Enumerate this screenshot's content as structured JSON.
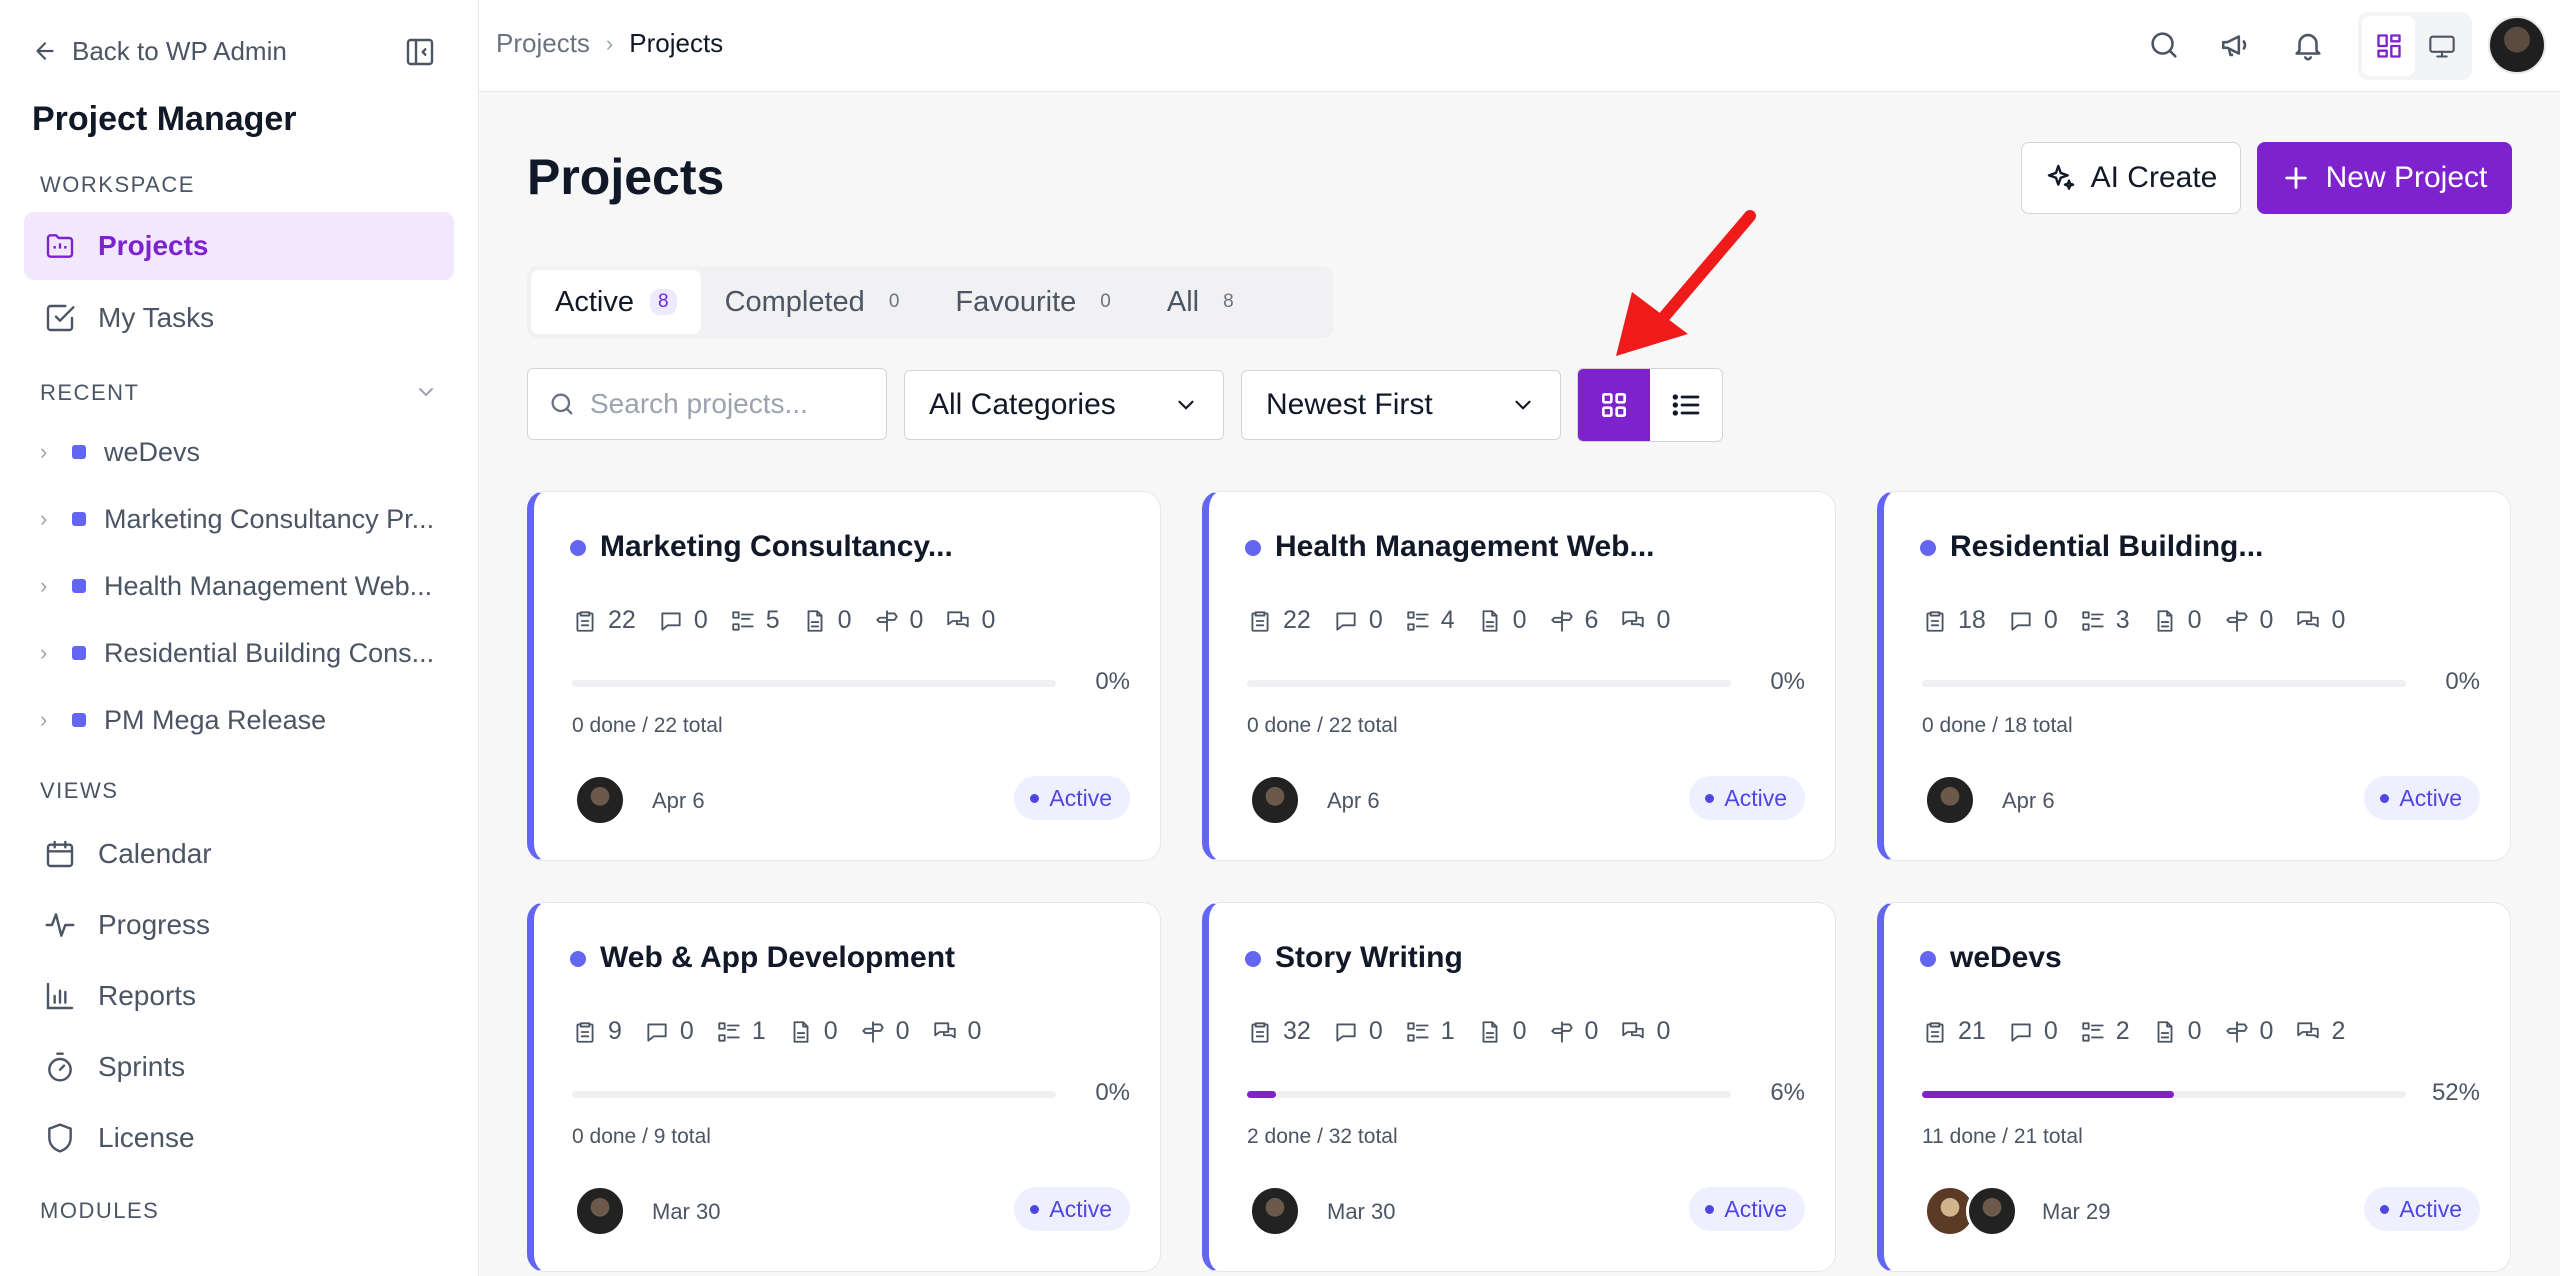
{
  "sidebar": {
    "back_label": "Back to WP Admin",
    "app_title": "Project Manager",
    "workspace_label": "WORKSPACE",
    "workspace_items": [
      {
        "label": "Projects",
        "icon": "folder-icon",
        "active": true
      },
      {
        "label": "My Tasks",
        "icon": "checkbox-icon",
        "active": false
      }
    ],
    "recent_label": "RECENT",
    "recent_items": [
      {
        "label": "weDevs"
      },
      {
        "label": "Marketing Consultancy Pr..."
      },
      {
        "label": "Health Management Web..."
      },
      {
        "label": "Residential Building Cons..."
      },
      {
        "label": "PM Mega Release"
      }
    ],
    "views_label": "VIEWS",
    "view_items": [
      {
        "label": "Calendar",
        "icon": "calendar-icon"
      },
      {
        "label": "Progress",
        "icon": "activity-icon"
      },
      {
        "label": "Reports",
        "icon": "bar-chart-icon"
      },
      {
        "label": "Sprints",
        "icon": "timer-icon"
      },
      {
        "label": "License",
        "icon": "shield-icon"
      }
    ],
    "modules_label": "MODULES"
  },
  "topbar": {
    "breadcrumb_parent": "Projects",
    "breadcrumb_current": "Projects"
  },
  "main": {
    "title": "Projects",
    "ai_create_label": "AI Create",
    "new_project_label": "New Project",
    "tabs": [
      {
        "label": "Active",
        "count": "8",
        "active": true
      },
      {
        "label": "Completed",
        "count": "0",
        "active": false
      },
      {
        "label": "Favourite",
        "count": "0",
        "active": false
      },
      {
        "label": "All",
        "count": "8",
        "active": false
      }
    ],
    "search_placeholder": "Search projects...",
    "category_select": "All Categories",
    "sort_select": "Newest First"
  },
  "colors": {
    "accent": "#7e22ce",
    "project": "#6366f1",
    "arrow": "#ef1b1b"
  },
  "projects": [
    {
      "title": "Marketing Consultancy...",
      "tasks": "22",
      "comments": "0",
      "lists": "5",
      "files": "0",
      "milestones": "0",
      "discussions": "0",
      "progress": 0,
      "percent": "0%",
      "done": "0 done / 22 total",
      "date": "Apr 6",
      "status": "Active",
      "avatars": 1
    },
    {
      "title": "Health Management Web...",
      "tasks": "22",
      "comments": "0",
      "lists": "4",
      "files": "0",
      "milestones": "6",
      "discussions": "0",
      "progress": 0,
      "percent": "0%",
      "done": "0 done / 22 total",
      "date": "Apr 6",
      "status": "Active",
      "avatars": 1
    },
    {
      "title": "Residential Building...",
      "tasks": "18",
      "comments": "0",
      "lists": "3",
      "files": "0",
      "milestones": "0",
      "discussions": "0",
      "progress": 0,
      "percent": "0%",
      "done": "0 done / 18 total",
      "date": "Apr 6",
      "status": "Active",
      "avatars": 1
    },
    {
      "title": "Web & App Development",
      "tasks": "9",
      "comments": "0",
      "lists": "1",
      "files": "0",
      "milestones": "0",
      "discussions": "0",
      "progress": 0,
      "percent": "0%",
      "done": "0 done / 9 total",
      "date": "Mar 30",
      "status": "Active",
      "avatars": 1
    },
    {
      "title": "Story Writing",
      "tasks": "32",
      "comments": "0",
      "lists": "1",
      "files": "0",
      "milestones": "0",
      "discussions": "0",
      "progress": 6,
      "percent": "6%",
      "done": "2 done / 32 total",
      "date": "Mar 30",
      "status": "Active",
      "avatars": 1
    },
    {
      "title": "weDevs",
      "tasks": "21",
      "comments": "0",
      "lists": "2",
      "files": "0",
      "milestones": "0",
      "discussions": "2",
      "progress": 52,
      "percent": "52%",
      "done": "11 done / 21 total",
      "date": "Mar 29",
      "status": "Active",
      "avatars": 2
    }
  ]
}
